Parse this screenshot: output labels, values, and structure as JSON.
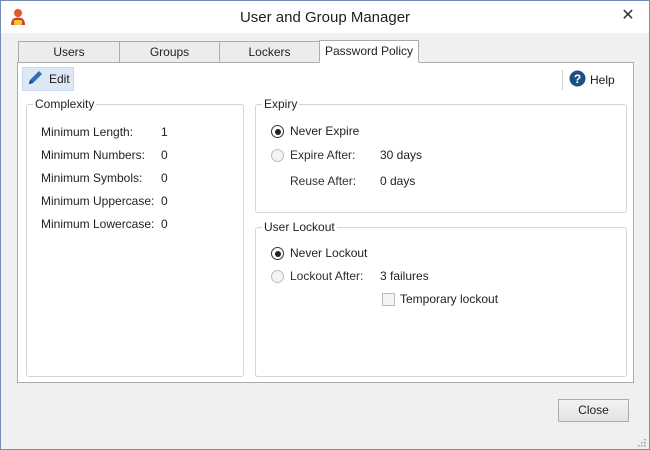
{
  "window": {
    "title": "User and Group Manager"
  },
  "tabs": [
    {
      "label": "Users",
      "active": false
    },
    {
      "label": "Groups",
      "active": false
    },
    {
      "label": "Lockers",
      "active": false
    },
    {
      "label": "Password Policy",
      "active": true
    }
  ],
  "toolbar": {
    "edit_label": "Edit",
    "help_label": "Help"
  },
  "complexity": {
    "legend": "Complexity",
    "rows": [
      {
        "label": "Minimum Length:",
        "value": "1"
      },
      {
        "label": "Minimum Numbers:",
        "value": "0"
      },
      {
        "label": "Minimum Symbols:",
        "value": "0"
      },
      {
        "label": "Minimum Uppercase:",
        "value": "0"
      },
      {
        "label": "Minimum Lowercase:",
        "value": "0"
      }
    ]
  },
  "expiry": {
    "legend": "Expiry",
    "never_label": "Never Expire",
    "never_selected": true,
    "after_label": "Expire After:",
    "after_value": "30 days",
    "reuse_label": "Reuse After:",
    "reuse_value": "0 days"
  },
  "lockout": {
    "legend": "User Lockout",
    "never_label": "Never Lockout",
    "never_selected": true,
    "after_label": "Lockout After:",
    "after_value": "3 failures",
    "temporary_label": "Temporary lockout",
    "temporary_checked": false
  },
  "footer": {
    "close_label": "Close"
  },
  "colors": {
    "accent": "#2f6db5",
    "help_icon": "#1e4f84",
    "titlebar": "#ffffff",
    "panel": "#f0f0f0"
  }
}
